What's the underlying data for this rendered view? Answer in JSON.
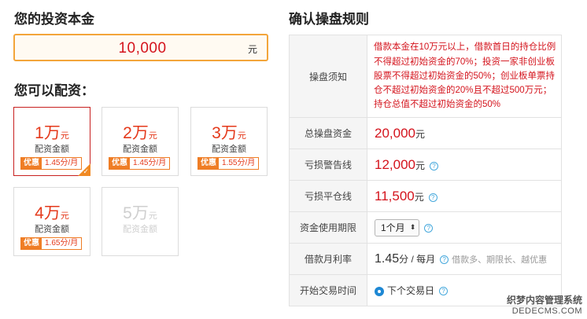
{
  "left": {
    "title": "您的投资本金",
    "amount": {
      "value": "10,000",
      "unit": "元"
    },
    "options_title": "您可以配资："
  },
  "cards": [
    {
      "num": "1",
      "wan": "万",
      "yuan": "元",
      "sub": "配资金额",
      "tag": "优惠",
      "rate": "1.45分/月"
    },
    {
      "num": "2",
      "wan": "万",
      "yuan": "元",
      "sub": "配资金额",
      "tag": "优惠",
      "rate": "1.45分/月"
    },
    {
      "num": "3",
      "wan": "万",
      "yuan": "元",
      "sub": "配资金额",
      "tag": "优惠",
      "rate": "1.55分/月"
    },
    {
      "num": "4",
      "wan": "万",
      "yuan": "元",
      "sub": "配资金额",
      "tag": "优惠",
      "rate": "1.65分/月"
    },
    {
      "num": "5",
      "wan": "万",
      "yuan": "元",
      "sub": "配资金额"
    }
  ],
  "selected_card": 0,
  "right": {
    "title": "确认操盘规则",
    "rows": {
      "notice": {
        "label": "操盘须知",
        "text": "借款本金在10万元以上，借款首日的持仓比例不得超过初始资金的70%；投资一家非创业板股票不得超过初始资金的50%；创业板单票持仓不超过初始资金的20%且不超过500万元；持仓总值不超过初始资金的50%"
      },
      "total": {
        "label": "总操盘资金",
        "value": "20,000",
        "unit": "元"
      },
      "warning": {
        "label": "亏损警告线",
        "value": "12,000",
        "unit": "元"
      },
      "closeout": {
        "label": "亏损平仓线",
        "value": "11,500",
        "unit": "元"
      },
      "period": {
        "label": "资金使用期限",
        "selected": "1个月"
      },
      "interest": {
        "label": "借款月利率",
        "value": "1.45",
        "unit": "分 / 每月",
        "hint": "借款多、期限长、越优惠"
      },
      "start": {
        "label": "开始交易时间",
        "option": "下个交易日"
      }
    }
  },
  "watermark": {
    "line1": "织梦内容管理系统",
    "line2": "DEDECMS.COM"
  },
  "colors": {
    "accent_red": "#d4131c",
    "orange": "#ef7d25",
    "link_blue": "#45a8dc"
  }
}
